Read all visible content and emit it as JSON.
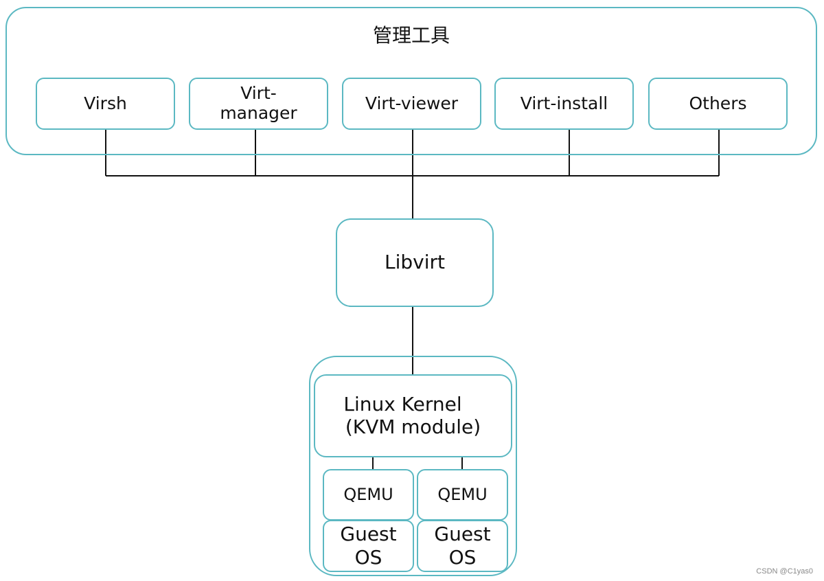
{
  "title": "管理工具",
  "tools": [
    "Virsh",
    "Virt-\nmanager",
    "Virt-viewer",
    "Virt-install",
    "Others"
  ],
  "libvirt": "Libvirt",
  "kernel": {
    "line1": "Linux Kernel",
    "line2": "(KVM module)"
  },
  "vms": [
    {
      "qemu": "QEMU",
      "guest": "Guest\nOS"
    },
    {
      "qemu": "QEMU",
      "guest": "Guest\nOS"
    }
  ],
  "watermark": "CSDN @C1yas0",
  "colors": {
    "border": "#5bb8c2",
    "line": "#111111"
  }
}
